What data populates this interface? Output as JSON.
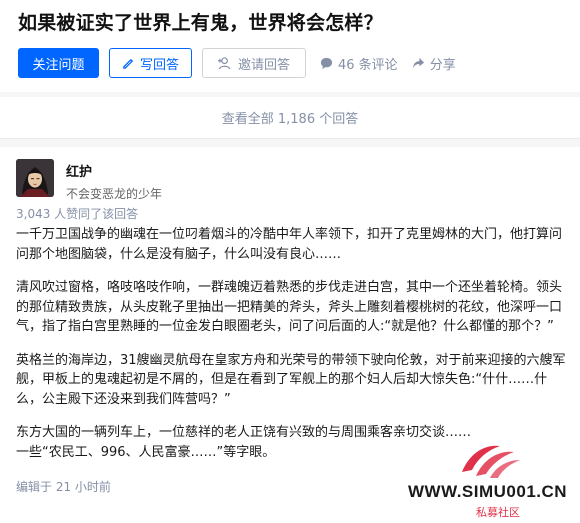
{
  "question": {
    "title": "如果被证实了世界上有鬼，世界将会怎样？"
  },
  "actions": {
    "follow": "关注问题",
    "write": "写回答",
    "invite": "邀请回答",
    "comments": "46 条评论",
    "share": "分享"
  },
  "view_all": "查看全部 1,186 个回答",
  "answer": {
    "author_name": "红护",
    "author_bio": "不会变恶龙的少年",
    "votes": "3,043 人赞同了该回答",
    "paragraphs": [
      "一千万卫国战争的幽魂在一位叼着烟斗的冷酷中年人率领下，扣开了克里姆林的大门，他打算问问那个地图脑袋，什么是没有脑子，什么叫没有良心……",
      "清风吹过窗格，咯吱咯吱作响，一群魂魄迈着熟悉的步伐走进白宫，其中一个还坐着轮椅。领头的那位精致贵族，从头皮靴子里抽出一把精美的斧头，斧头上雕刻着樱桃树的花纹，他深呼一口气，指了指白宫里熟睡的一位金发白眼圈老头，问了问后面的人:“就是他？什么都懂的那个？”",
      "英格兰的海岸边，31艘幽灵航母在皇家方舟和光荣号的带领下驶向伦敦，对于前来迎接的六艘军舰，甲板上的鬼魂起初是不屑的，但是在看到了军舰上的那个妇人后却大惊失色:“什什……什么，公主殿下还没来到我们阵营吗？”",
      "东方大国的一辆列车上，一位慈祥的老人正饶有兴致的与周围乘客亲切交谈……",
      "一些“农民工、996、人民富豪……”等字眼。"
    ],
    "edited": "编辑于 21 小时前"
  },
  "watermark": {
    "domain": "WWW.SIMU001.CN",
    "sub": "私募社区"
  },
  "colors": {
    "primary": "#0066ff",
    "meta": "#8590a6",
    "watermark_red": "#e0314a"
  }
}
